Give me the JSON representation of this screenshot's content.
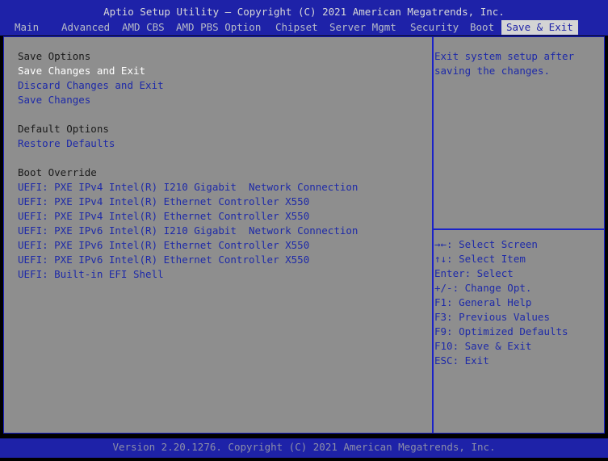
{
  "header": {
    "title": "Aptio Setup Utility – Copyright (C) 2021 American Megatrends, Inc.",
    "tabs": [
      {
        "label": "Main"
      },
      {
        "label": "Advanced"
      },
      {
        "label": "AMD CBS"
      },
      {
        "label": "AMD PBS Option"
      },
      {
        "label": "Chipset"
      },
      {
        "label": "Server Mgmt"
      },
      {
        "label": "Security"
      },
      {
        "label": "Boot"
      },
      {
        "label": "Save & Exit",
        "active": true
      }
    ]
  },
  "main": {
    "save_options_heading": "Save Options",
    "save_changes_and_exit": "Save Changes and Exit",
    "discard_changes_and_exit": "Discard Changes and Exit",
    "save_changes": "Save Changes",
    "default_options_heading": "Default Options",
    "restore_defaults": "Restore Defaults",
    "boot_override_heading": "Boot Override",
    "boot_items": [
      "UEFI: PXE IPv4 Intel(R) I210 Gigabit  Network Connection",
      "UEFI: PXE IPv4 Intel(R) Ethernet Controller X550",
      "UEFI: PXE IPv4 Intel(R) Ethernet Controller X550",
      "UEFI: PXE IPv6 Intel(R) I210 Gigabit  Network Connection",
      "UEFI: PXE IPv6 Intel(R) Ethernet Controller X550",
      "UEFI: PXE IPv6 Intel(R) Ethernet Controller X550",
      "UEFI: Built-in EFI Shell"
    ]
  },
  "help": {
    "description": "Exit system setup after saving the changes.",
    "keys": [
      "→←: Select Screen",
      "↑↓: Select Item",
      "Enter: Select",
      "+/-: Change Opt.",
      "F1: General Help",
      "F3: Previous Values",
      "F9: Optimized Defaults",
      "F10: Save & Exit",
      "ESC: Exit"
    ]
  },
  "footer": {
    "text": "Version 2.20.1276. Copyright (C) 2021 American Megatrends, Inc."
  },
  "colors": {
    "header_bg": "#1e22a8",
    "panel_bg": "#8e8e8e",
    "link_text": "#1e2aa8",
    "selected_text": "#ffffff"
  }
}
